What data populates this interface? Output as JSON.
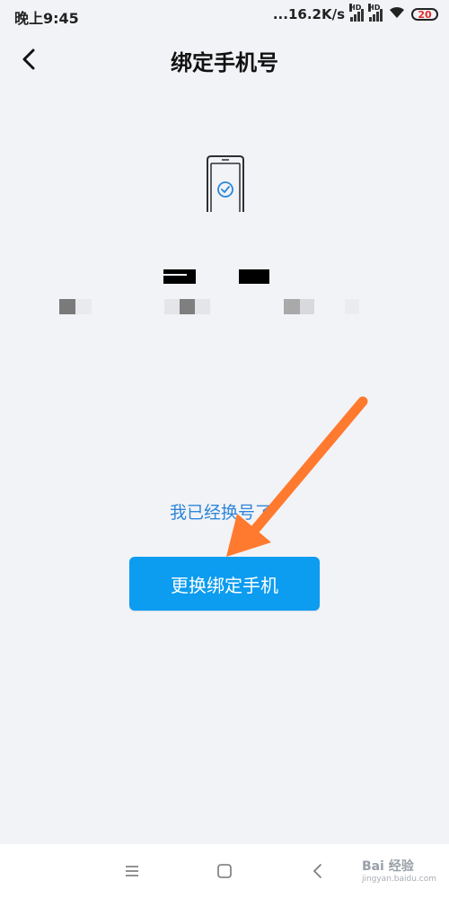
{
  "status_bar": {
    "time": "晚上9:45",
    "network_speed": "...16.2K/s",
    "battery": "20",
    "signal_label": "HD",
    "colors": {
      "battery_low": "#e52b2b"
    },
    "icons": [
      "signal-icon",
      "signal-icon",
      "wifi-icon",
      "battery-icon"
    ]
  },
  "header": {
    "back_icon": "chevron-left-icon",
    "title": "绑定手机号"
  },
  "content": {
    "illustration_icon": "phone-check-icon",
    "phone_number": "masked",
    "description": "masked"
  },
  "actions": {
    "changed_number_link": "我已经换号了",
    "rebind_button": "更换绑定手机"
  },
  "system_nav": {
    "menu_icon": "menu-icon",
    "home_icon": "square-home-icon",
    "back_icon": "chevron-left-icon"
  },
  "watermark": {
    "text": "Bai 经验",
    "sub": "jingyan.baidu.com"
  },
  "colors": {
    "background": "#f2f3f7",
    "accent": "#0c9cf0",
    "link": "#2d86d9",
    "annotation_arrow": "#ff7a2e"
  }
}
